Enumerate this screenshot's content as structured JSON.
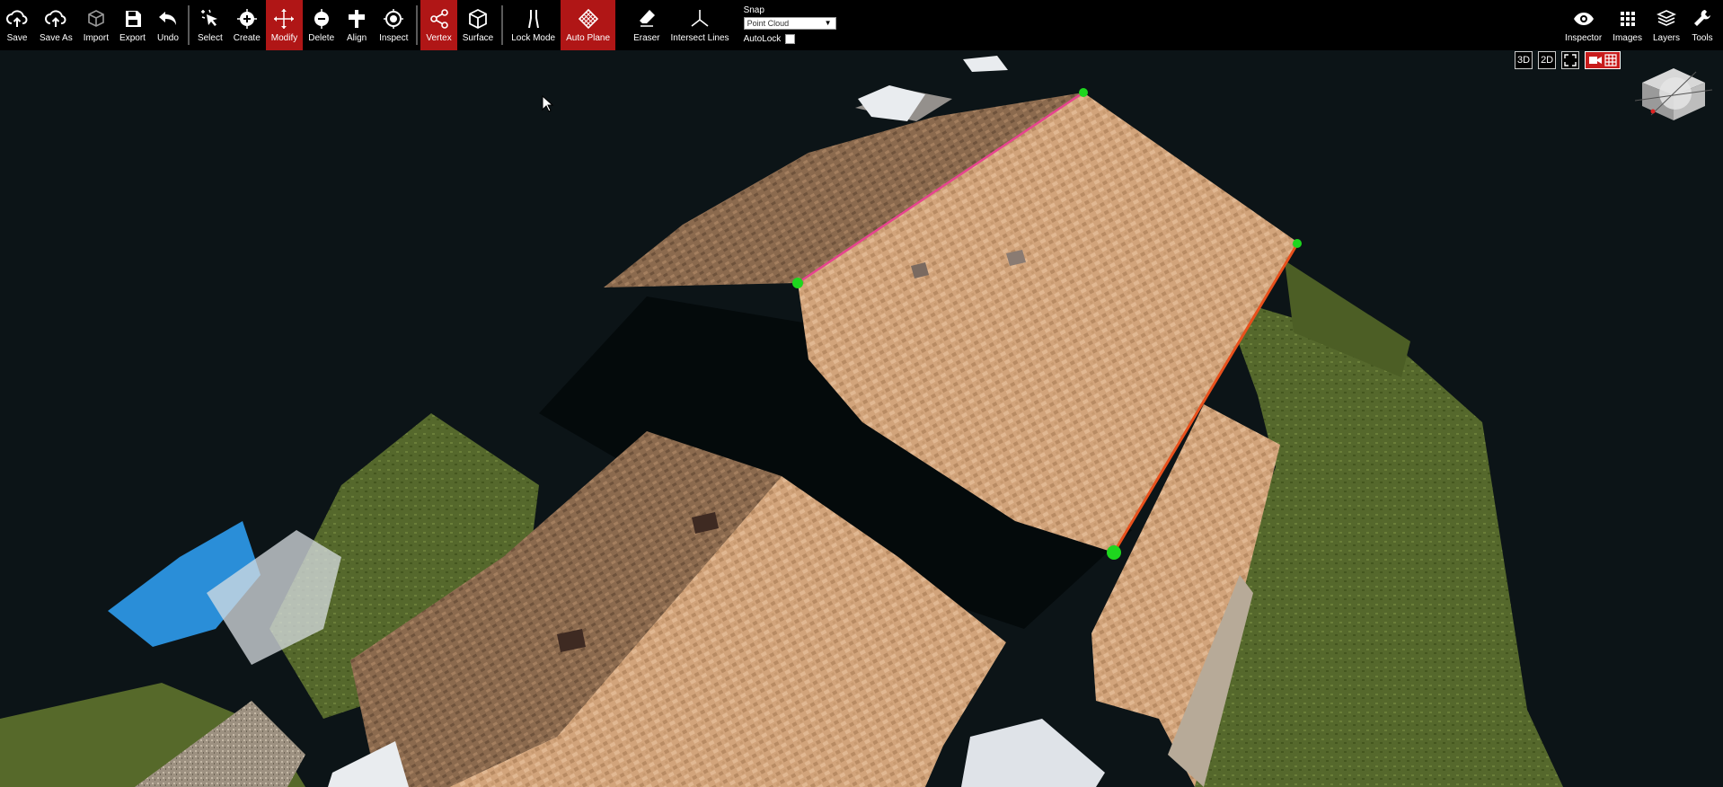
{
  "toolbar": {
    "file": [
      {
        "label": "Save",
        "icon": "cloud-upload-icon"
      },
      {
        "label": "Save As",
        "icon": "cloud-upload-icon"
      },
      {
        "label": "Import",
        "icon": "cube-outline-icon"
      },
      {
        "label": "Export",
        "icon": "floppy-disk-icon"
      },
      {
        "label": "Undo",
        "icon": "undo-arrow-icon"
      }
    ],
    "tools": [
      {
        "label": "Select",
        "icon": "select-cursor-icon"
      },
      {
        "label": "Create",
        "icon": "plus-circle-icon"
      },
      {
        "label": "Modify",
        "icon": "move-arrows-icon",
        "active": true
      },
      {
        "label": "Delete",
        "icon": "minus-circle-icon"
      },
      {
        "label": "Align",
        "icon": "align-icon"
      },
      {
        "label": "Inspect",
        "icon": "target-icon"
      }
    ],
    "modes": [
      {
        "label": "Vertex",
        "icon": "vertex-share-icon",
        "active": true
      },
      {
        "label": "Surface",
        "icon": "cube-surface-icon"
      }
    ],
    "lock": [
      {
        "label": "Lock Mode",
        "icon": "lock-lines-icon"
      },
      {
        "label": "Auto Plane",
        "icon": "grid-diamond-icon",
        "active": true
      }
    ],
    "extra": [
      {
        "label": "Eraser",
        "icon": "eraser-icon"
      },
      {
        "label": "Intersect Lines",
        "icon": "intersect-lines-icon"
      }
    ],
    "snap": {
      "label": "Snap",
      "value": "Point Cloud",
      "autolock_label": "AutoLock"
    },
    "right": [
      {
        "label": "Inspector",
        "icon": "eye-icon"
      },
      {
        "label": "Images",
        "icon": "grid-dots-icon"
      },
      {
        "label": "Layers",
        "icon": "layers-icon"
      },
      {
        "label": "Tools",
        "icon": "wrench-icon"
      }
    ]
  },
  "view_controls": {
    "btn_3d": "3D",
    "btn_2d": "2D"
  },
  "colors": {
    "active": "#b01616",
    "vertex": "#1ed61e",
    "edge_ridge": "#e6448f",
    "edge_rake": "#e8501c",
    "shingle_light": "#d4a77e",
    "shingle_dark": "#8c6a4e",
    "grass": "#566b2c"
  }
}
